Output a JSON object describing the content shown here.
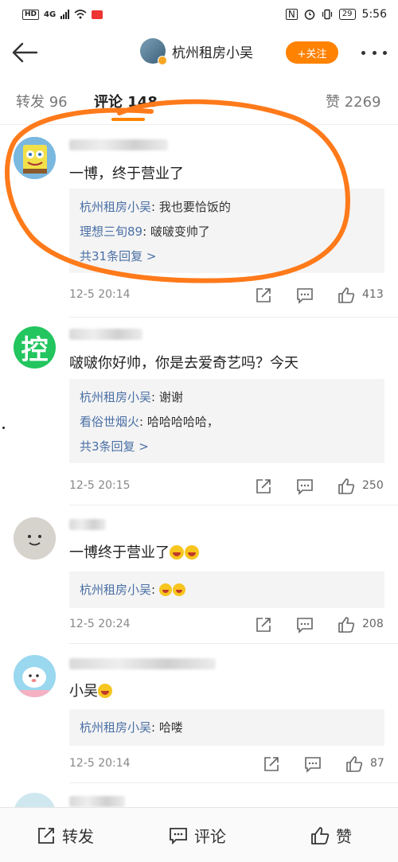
{
  "status_bar": {
    "hd": "HD",
    "network": "4G",
    "battery": "29",
    "time": "5:56"
  },
  "header": {
    "title": "杭州租房小吴",
    "follow_label": "+关注"
  },
  "tabs": {
    "repost": "转发 96",
    "comments": "评论 148",
    "likes": "赞 2269"
  },
  "comments": [
    {
      "text": "一博，终于营业了",
      "replies": [
        {
          "author": "杭州租房小吴",
          "text": ": 我也要恰饭的"
        },
        {
          "author": "理想三旬89",
          "text": ": 啵啵变帅了"
        }
      ],
      "more": "共31条回复 >",
      "time": "12-5 20:14",
      "likes": "413",
      "avatar": "spongebob"
    },
    {
      "text": "啵啵你好帅，你是去爱奇艺吗？今天",
      "replies": [
        {
          "author": "杭州租房小吴",
          "text": ": 谢谢"
        },
        {
          "author": "看俗世烟火",
          "text": ": 哈哈哈哈哈，"
        }
      ],
      "more": "共3条回复 >",
      "time": "12-5 20:15",
      "likes": "250",
      "avatar_char": "控"
    },
    {
      "text": "一博终于营业了",
      "replies": [
        {
          "author": "杭州租房小吴",
          "text": ": "
        }
      ],
      "time": "12-5 20:24",
      "likes": "208",
      "avatar": "smiley"
    },
    {
      "text": "小吴",
      "replies": [
        {
          "author": "杭州租房小吴",
          "text": ": 哈喽"
        }
      ],
      "time": "12-5 20:14",
      "likes": "87",
      "avatar": "ghost"
    }
  ],
  "bottom_bar": {
    "repost": "转发",
    "comment": "评论",
    "like": "赞"
  },
  "colors": {
    "accent": "#ff8200",
    "link": "#4a6fa5",
    "annotation": "#ff7a1a"
  },
  "icons": [
    "back-arrow-icon",
    "verified-icon",
    "more-icon",
    "repost-icon",
    "comment-icon",
    "like-icon",
    "laughing-emoji-icon"
  ]
}
